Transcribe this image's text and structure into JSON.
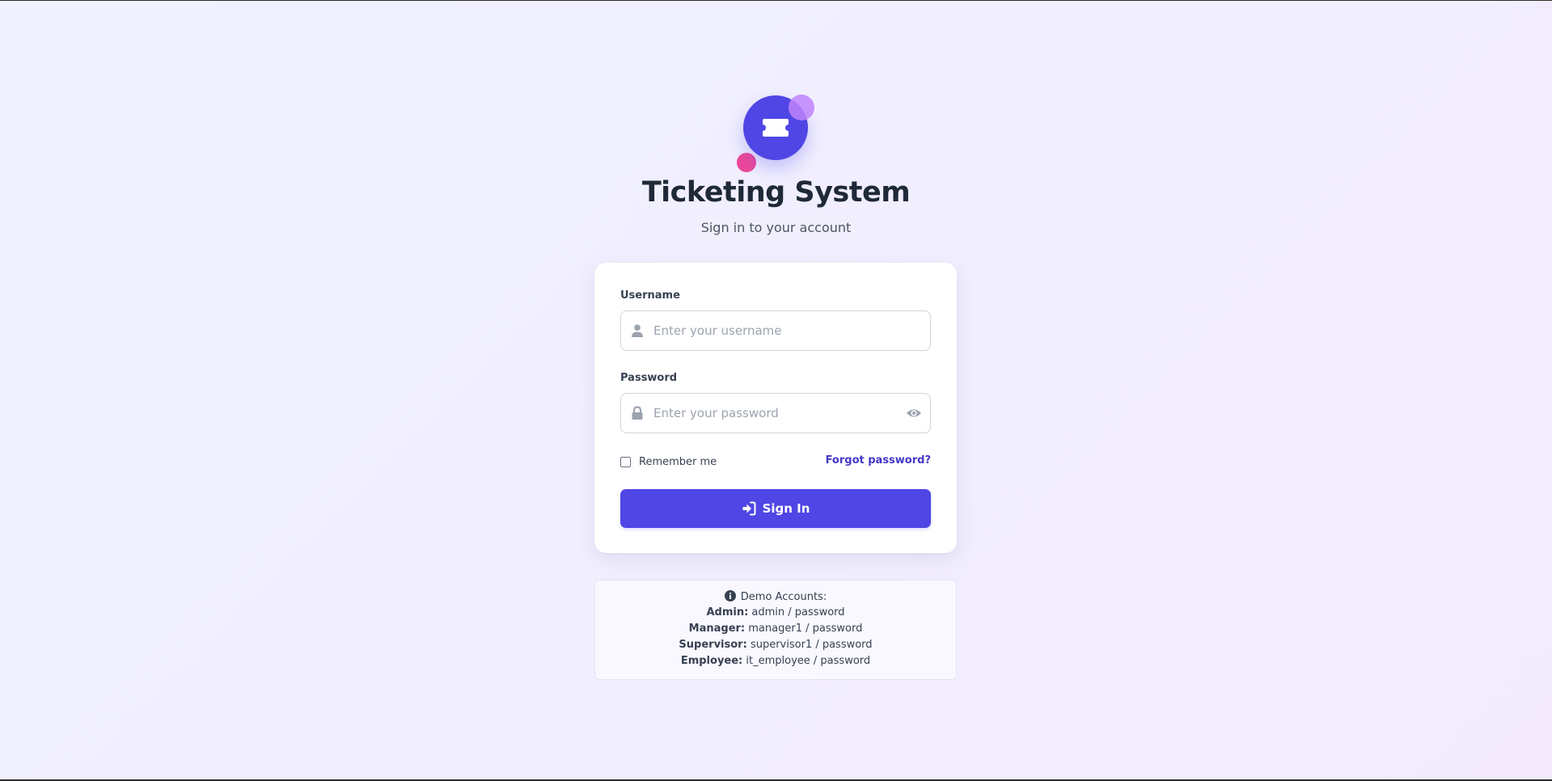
{
  "app": {
    "title": "Ticketing System",
    "subtitle": "Sign in to your account"
  },
  "form": {
    "username_label": "Username",
    "username_placeholder": "Enter your username",
    "username_value": "",
    "password_label": "Password",
    "password_placeholder": "Enter your password",
    "password_value": "",
    "remember_label": "Remember me",
    "remember_checked": false,
    "forgot_label": "Forgot password?",
    "signin_label": "Sign In"
  },
  "demo": {
    "heading": "Demo Accounts:",
    "accounts": [
      {
        "role": "Admin:",
        "credentials": "admin / password"
      },
      {
        "role": "Manager:",
        "credentials": "manager1 / password"
      },
      {
        "role": "Supervisor:",
        "credentials": "supervisor1 / password"
      },
      {
        "role": "Employee:",
        "credentials": "it_employee / password"
      }
    ]
  },
  "colors": {
    "primary": "#4f46e5",
    "accent_pink": "#ec4899",
    "accent_purple": "#c084fc",
    "link": "#4338ca"
  },
  "icons": {
    "logo": "ticket-icon",
    "username": "user-icon",
    "password": "lock-icon",
    "toggle_password": "eye-icon",
    "signin": "sign-in-icon",
    "info": "info-circle-icon"
  }
}
